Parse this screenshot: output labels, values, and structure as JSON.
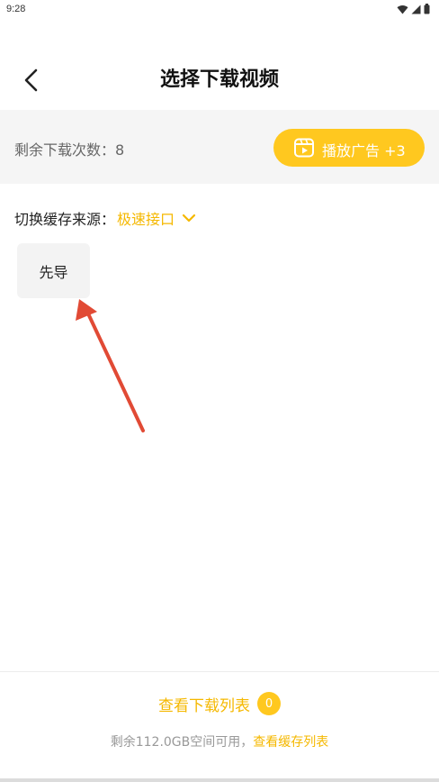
{
  "status_bar": {
    "time": "9:28"
  },
  "header": {
    "title": "选择下载视频"
  },
  "quota": {
    "remaining_text": "剩余下载次数：8",
    "ad_button_label": "播放广告 +3"
  },
  "source": {
    "label": "切换缓存来源：",
    "value": "极速接口"
  },
  "episodes": [
    {
      "label": "先导"
    }
  ],
  "footer": {
    "download_list_label": "查看下载列表",
    "download_count": "0",
    "storage_text": "剩余112.0GB空间可用，",
    "cache_list_link": "查看缓存列表"
  },
  "colors": {
    "accent": "#ffc81f",
    "accent_text": "#f5b800",
    "annotation_arrow": "#e14a35"
  },
  "icons": [
    "back-arrow-icon",
    "play-video-icon",
    "chevron-down-icon",
    "wifi-icon",
    "signal-icon",
    "battery-icon"
  ]
}
